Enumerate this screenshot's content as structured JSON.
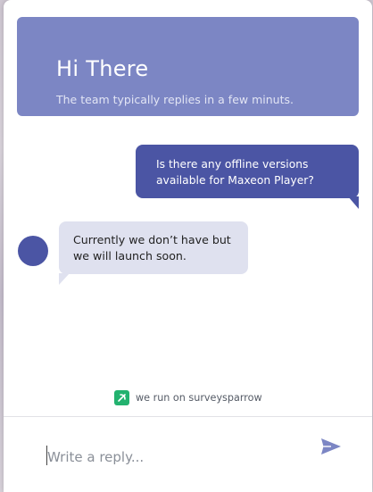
{
  "header": {
    "title": "Hi There",
    "subtitle": "The team typically replies in a few minuts."
  },
  "messages": [
    {
      "direction": "outgoing",
      "text": "Is there any offline versions available for Maxeon Player?"
    },
    {
      "direction": "incoming",
      "text": "Currently we don’t have but we will launch soon."
    }
  ],
  "branding": {
    "text": "we run on surveysparrow",
    "icon": "surveysparrow-logo-icon"
  },
  "composer": {
    "placeholder": "Write a reply...",
    "value": "",
    "send_icon": "send-icon"
  },
  "colors": {
    "header_bg": "#7c86c4",
    "outgoing_bubble": "#4b55a4",
    "incoming_bubble": "#dfe1ef",
    "avatar": "#4b55a4",
    "brand_green": "#23b26f",
    "send_icon": "#7c86c4"
  }
}
